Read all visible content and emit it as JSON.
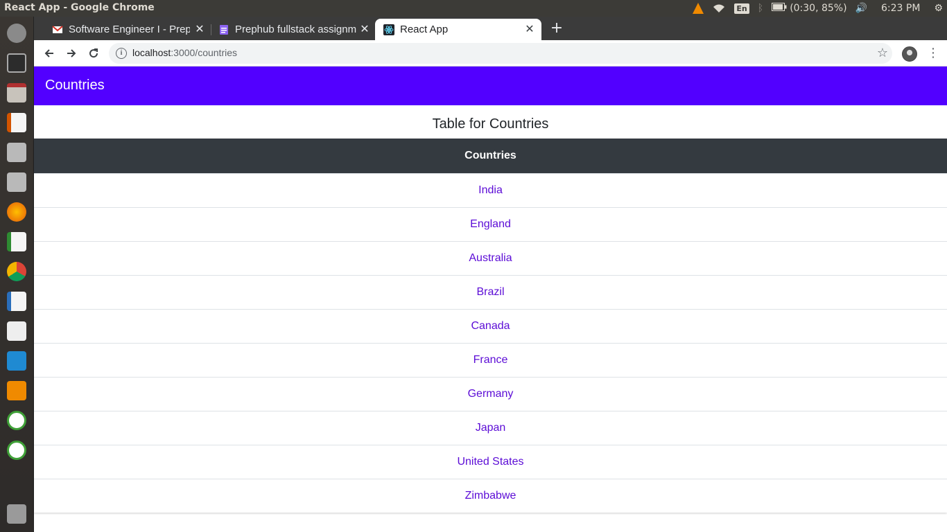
{
  "window": {
    "title": "React App - Google Chrome",
    "tray": {
      "input_method": "En",
      "battery": "(0:30, 85%)",
      "clock": "6:23 PM"
    }
  },
  "launcher": {
    "items": [
      "ubuntu-dash-icon",
      "terminal-icon",
      "files-icon",
      "impress-icon",
      "disk-drive-icon",
      "disk-drive-2-icon",
      "firefox-icon",
      "calc-icon",
      "chrome-icon",
      "writer-icon",
      "text-editor-icon",
      "vscode-icon",
      "vlc-icon",
      "mongodb-compass-icon",
      "mongodb-compass-2-icon",
      "trash-icon"
    ]
  },
  "browser": {
    "tabs": [
      {
        "label": "Software Engineer I - Prep",
        "favicon": "gmail-icon",
        "active": false
      },
      {
        "label": "Prephub fullstack assignm",
        "favicon": "docs-icon",
        "active": false
      },
      {
        "label": "React App",
        "favicon": "react-icon",
        "active": true
      }
    ],
    "url_host": "localhost",
    "url_rest": ":3000/countries"
  },
  "app": {
    "title": "Countries",
    "caption": "Table for Countries",
    "table": {
      "header": "Countries",
      "rows": [
        "India",
        "England",
        "Australia",
        "Brazil",
        "Canada",
        "France",
        "Germany",
        "Japan",
        "United States",
        "Zimbabwe"
      ]
    }
  },
  "colors": {
    "appbar": "#5200ff",
    "thead": "#343a40",
    "link": "#5b0bd6"
  }
}
